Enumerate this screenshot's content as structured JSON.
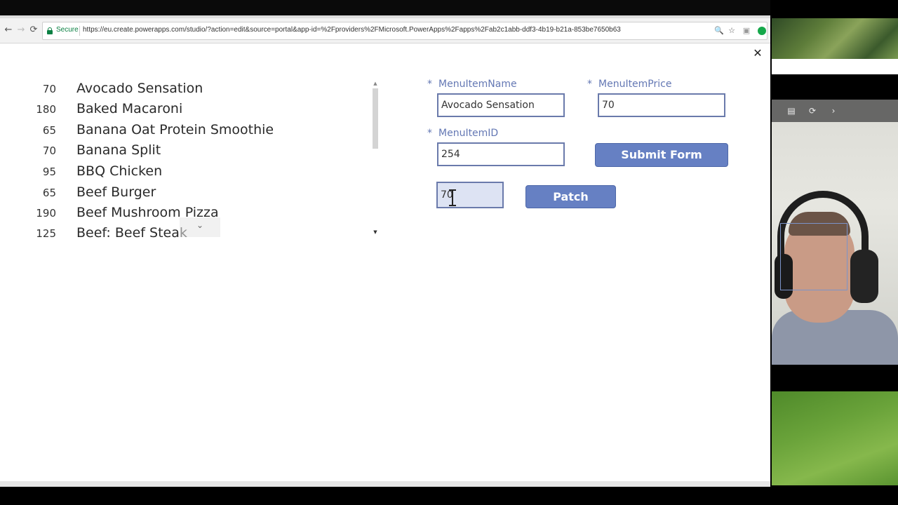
{
  "browser": {
    "secure_label": "Secure",
    "url": "https://eu.create.powerapps.com/studio/?action=edit&source=portal&app-id=%2Fproviders%2FMicrosoft.PowerApps%2Fapps%2Fab2c1abb-ddf3-4b19-b21a-853be7650b63",
    "back_glyph": "←",
    "forward_glyph": "→",
    "reload_glyph": "⟳",
    "zoom_glyph": "🔍",
    "star_glyph": "☆",
    "extension_glyph": "▣"
  },
  "app": {
    "close_glyph": "✕",
    "gallery": {
      "items": [
        {
          "price": "70",
          "name": "Avocado Sensation"
        },
        {
          "price": "180",
          "name": "Baked Macaroni"
        },
        {
          "price": "65",
          "name": "Banana Oat Protein Smoothie"
        },
        {
          "price": "70",
          "name": "Banana Split"
        },
        {
          "price": "95",
          "name": "BBQ Chicken"
        },
        {
          "price": "65",
          "name": "Beef Burger"
        },
        {
          "price": "190",
          "name": "Beef Mushroom Pizza"
        },
        {
          "price": "125",
          "name": "Beef: Beef Steak"
        }
      ],
      "scroll_up_glyph": "▲",
      "scroll_down_glyph": "▼",
      "next_glyph": "⌄"
    },
    "form": {
      "required_mark": "*",
      "name_label": "MenuItemName",
      "name_value": "Avocado Sensation",
      "price_label": "MenuItemPrice",
      "price_value": "70",
      "id_label": "MenuItemID",
      "id_value": "254",
      "submit_label": "Submit Form",
      "patch_input_value": "70",
      "patch_label": "Patch"
    }
  },
  "webcam": {
    "captions_glyph": "▤",
    "speed_glyph": "⟳",
    "next_glyph": "›"
  },
  "colors": {
    "label": "#6478b4",
    "button": "#6680c3",
    "input_border": "#6a7aab",
    "secure": "#0b8043"
  }
}
